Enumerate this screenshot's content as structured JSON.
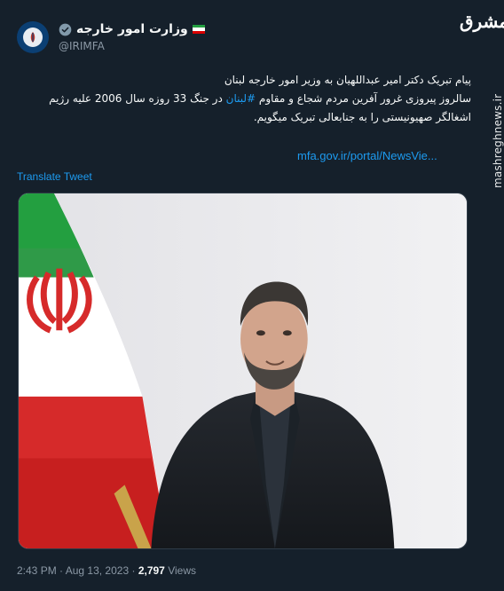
{
  "account": {
    "name": "وزارت امور خارجه",
    "handle": "@IRIMFA",
    "verified_icon": "verified-badge-icon",
    "flag_icon": "iran-flag-icon"
  },
  "tweet": {
    "lines": [
      "پیام تبریک دکتر امیر عبداللهیان به وزیر امور خارجه لبنان",
      "سالروز پیروزی غرور آفرین مردم شجاع و مقاوم",
      "در جنگ 33 روزه سال 2006 علیه رژیم",
      "اشغالگر صهیونیستی را به جنابعالی تبریک میگویم."
    ],
    "hashtag": "#لبنان",
    "link": "mfa.gov.ir/portal/NewsVie...",
    "translate": "Translate Tweet"
  },
  "footer": {
    "time": "2:43 PM",
    "separator": "·",
    "date": "Aug 13, 2023",
    "views_count": "2,797",
    "views_label": "Views"
  },
  "watermark": {
    "logo_text": "مشرق",
    "site": "mashreghnews.ir"
  },
  "colors": {
    "background": "#15202b",
    "accent": "#1d9bf0",
    "muted": "#8b98a5"
  }
}
